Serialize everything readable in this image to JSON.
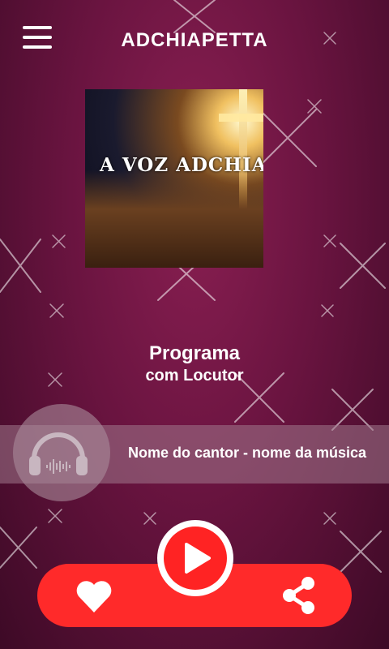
{
  "header": {
    "title": "ADCHIAPETTA",
    "menu_icon": "hamburger-menu-icon"
  },
  "cover": {
    "text": "A VOZ ADCHIAPETT"
  },
  "program": {
    "title": "Programa",
    "subtitle": "com Locutor"
  },
  "now_playing": {
    "text": "Nome do cantor - nome da música",
    "icon": "headphones-icon"
  },
  "controls": {
    "like_icon": "heart-icon",
    "play_icon": "play-icon",
    "share_icon": "share-icon"
  },
  "colors": {
    "background": "#6a1440",
    "accent": "#ff2a2a"
  }
}
